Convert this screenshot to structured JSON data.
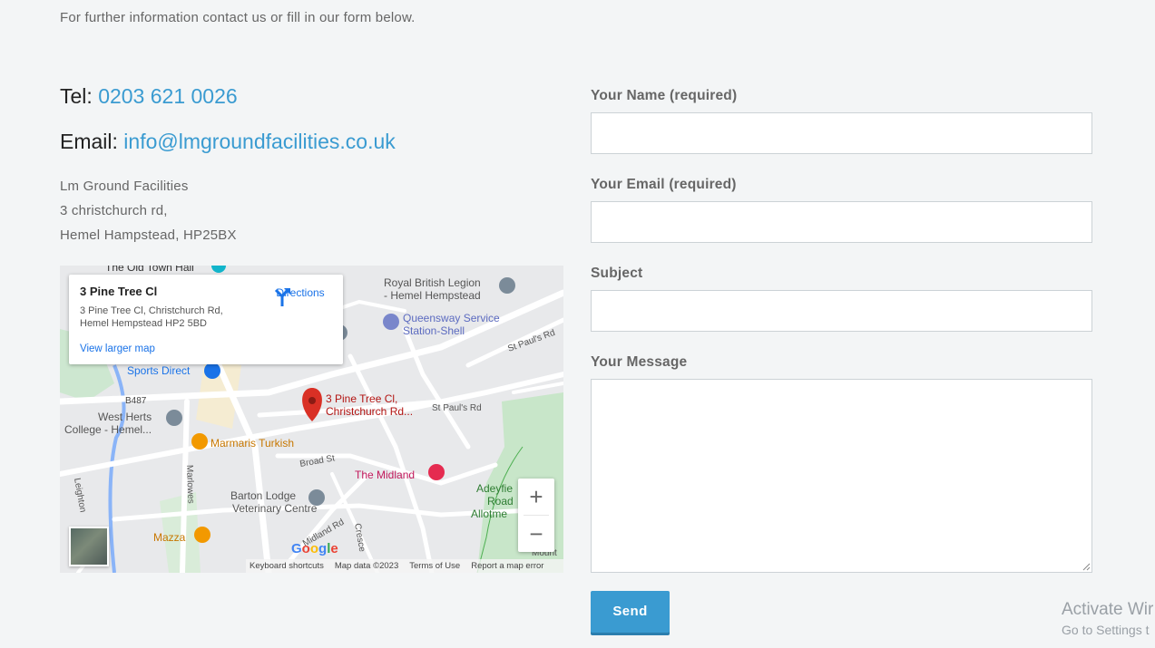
{
  "intro": "For further information contact us or fill in our form below.",
  "contact": {
    "tel_label": "Tel:",
    "tel_value": "0203 621 0026",
    "email_label": "Email:",
    "email_value": "info@lmgroundfacilities.co.uk",
    "address": [
      "Lm Ground Facilities",
      "3 christchurch rd,",
      "Hemel Hampstead, HP25BX"
    ]
  },
  "map": {
    "card_title": "3 Pine Tree Cl",
    "card_subtitle": "3 Pine Tree Cl, Christchurch Rd, Hemel Hempstead HP2 5BD",
    "directions_label": "Directions",
    "view_larger": "View larger map",
    "pin_label_1": "3 Pine Tree Cl,",
    "pin_label_2": "Christchurch Rd...",
    "places": {
      "old_town_hall": "The Old Town Hall",
      "royal_legion_1": "Royal British Legion",
      "royal_legion_2": "- Hemel Hempstead",
      "queensway_1": "Queensway Service",
      "queensway_2": "Station-Shell",
      "sports_direct": "Sports Direct",
      "west_herts_1": "West Herts",
      "west_herts_2": "College - Hemel...",
      "marmaris": "Marmaris Turkish",
      "midland": "The Midland",
      "barton_1": "Barton Lodge",
      "barton_2": "Veterinary Centre",
      "mazza": "Mazza",
      "adeyfield_1": "Adeyfie",
      "adeyfield_2": "Road",
      "adeyfield_3": "Allotme",
      "road_b487": "B487",
      "road_st_pauls": "St Paul's Rd",
      "road_st_pauls_2": "St Paul's Rd",
      "road_broad": "Broad St",
      "road_marlowes": "Marlowes",
      "road_midland": "Midland Rd",
      "road_crescent": "Cresce",
      "road_leighton": "Leighton",
      "road_mount": "Mount"
    },
    "google": "Google",
    "footer": [
      "Keyboard shortcuts",
      "Map data ©2023",
      "Terms of Use",
      "Report a map error"
    ],
    "zoom_in": "+",
    "zoom_out": "−"
  },
  "form": {
    "name_label": "Your Name (required)",
    "email_label": "Your Email (required)",
    "subject_label": "Subject",
    "message_label": "Your Message",
    "send_label": "Send"
  },
  "watermark": {
    "line1": "Activate Wir",
    "line2": "Go to Settings t"
  },
  "colors": {
    "accent": "#3a9bd1",
    "background": "#f3f5f6",
    "map_pin": "#d93025"
  }
}
